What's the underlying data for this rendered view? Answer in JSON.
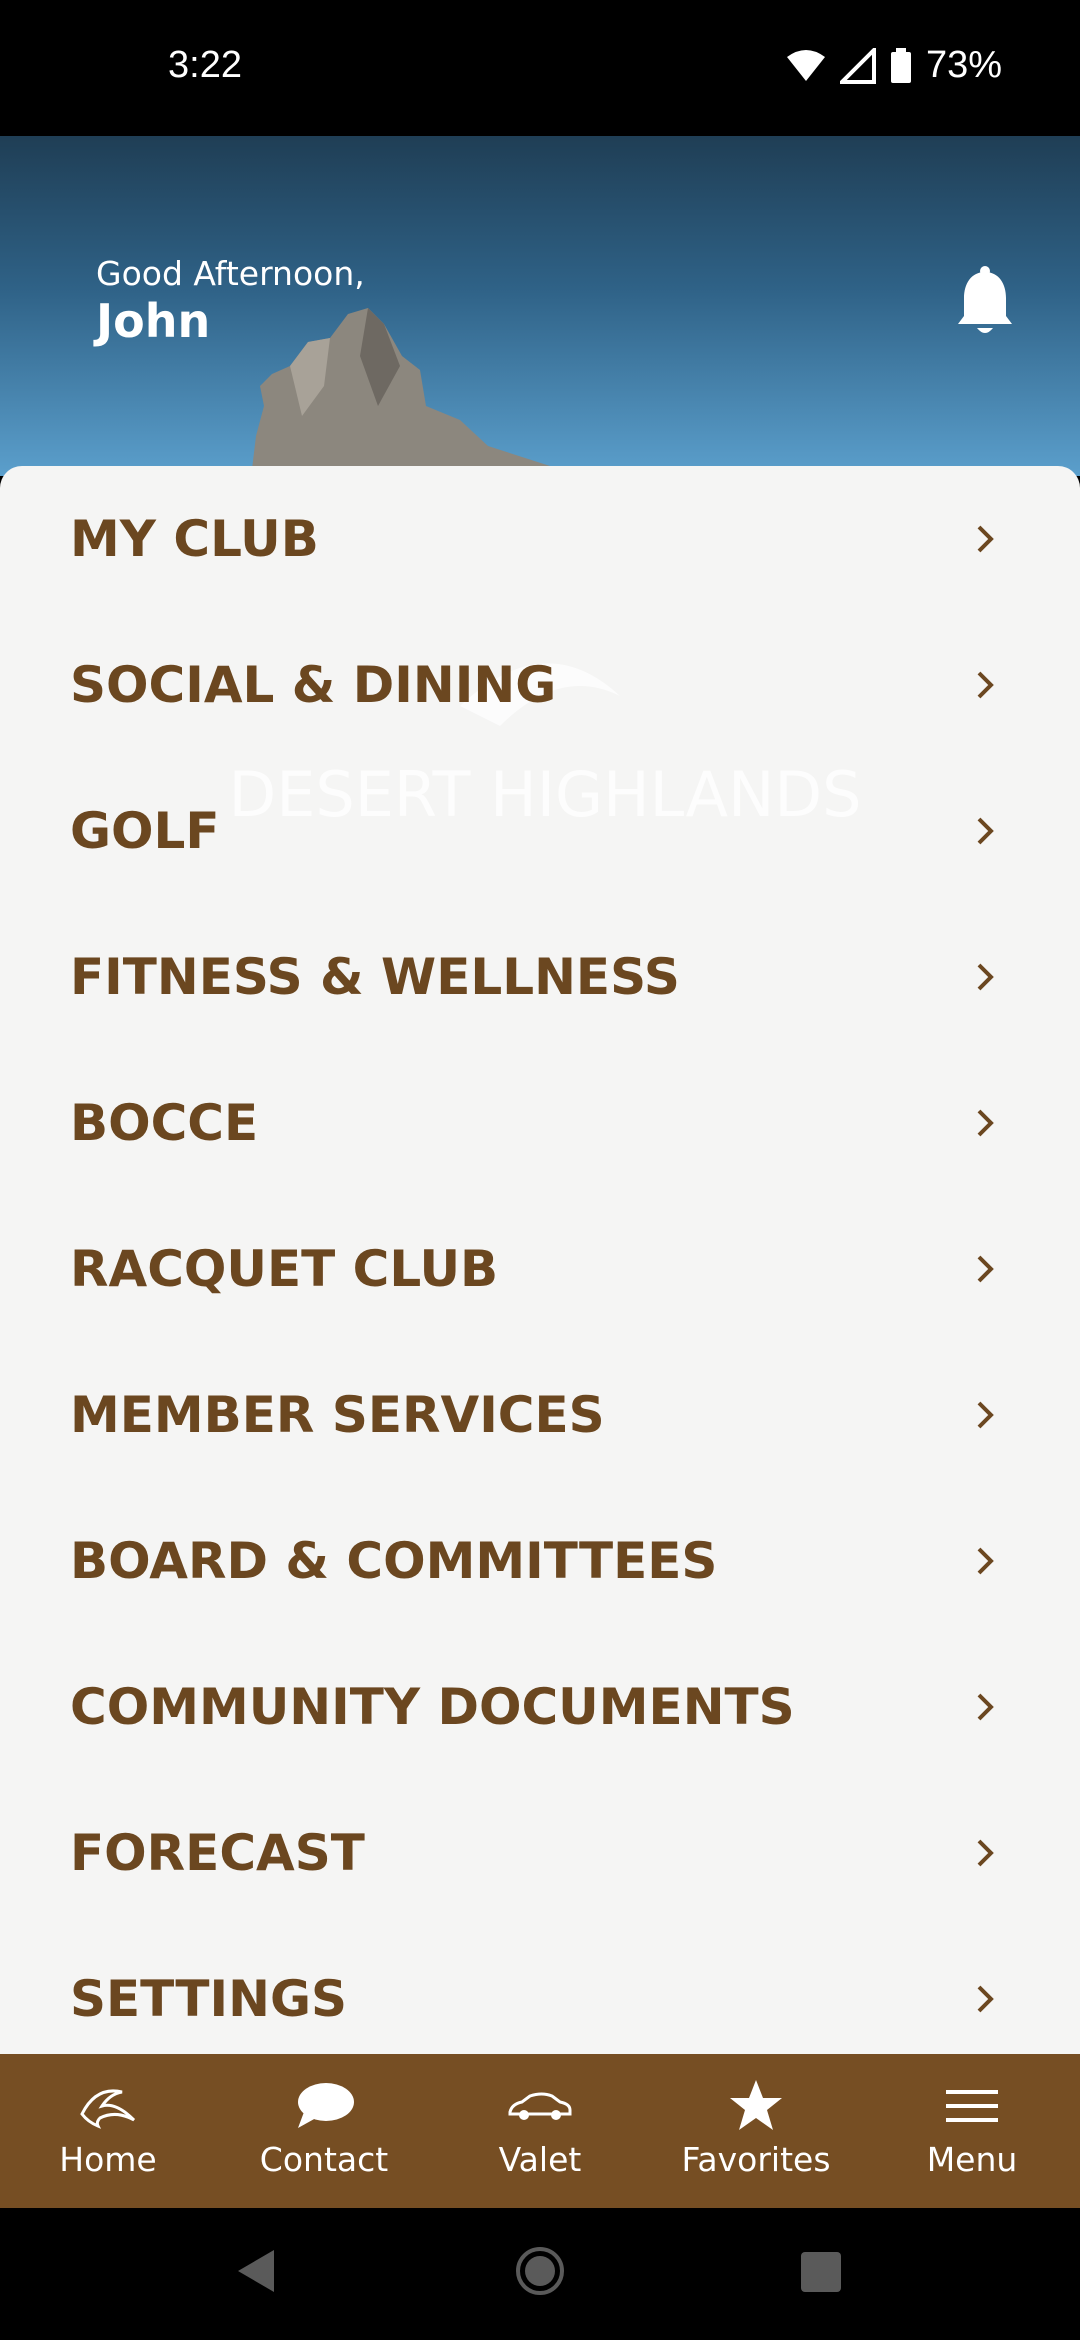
{
  "status_bar": {
    "time": "3:22",
    "battery": "73%"
  },
  "header": {
    "greeting": "Good Afternoon,",
    "user_name": "John"
  },
  "menu": {
    "items": [
      {
        "label": "MY CLUB"
      },
      {
        "label": "SOCIAL & DINING"
      },
      {
        "label": "GOLF"
      },
      {
        "label": "FITNESS & WELLNESS"
      },
      {
        "label": "BOCCE"
      },
      {
        "label": "RACQUET CLUB"
      },
      {
        "label": "MEMBER SERVICES"
      },
      {
        "label": "BOARD & COMMITTEES"
      },
      {
        "label": "COMMUNITY DOCUMENTS"
      },
      {
        "label": "FORECAST"
      },
      {
        "label": "SETTINGS"
      }
    ]
  },
  "watermark": {
    "text": "DESERT HIGHLANDS"
  },
  "bottom_nav": {
    "items": [
      {
        "label": "Home",
        "icon": "club-logo-icon"
      },
      {
        "label": "Contact",
        "icon": "chat-bubble-icon"
      },
      {
        "label": "Valet",
        "icon": "car-icon"
      },
      {
        "label": "Favorites",
        "icon": "star-icon"
      },
      {
        "label": "Menu",
        "icon": "hamburger-icon"
      }
    ]
  },
  "colors": {
    "brand_brown": "#764e23",
    "menu_text": "#6b4720",
    "panel_bg": "#f5f5f4"
  }
}
